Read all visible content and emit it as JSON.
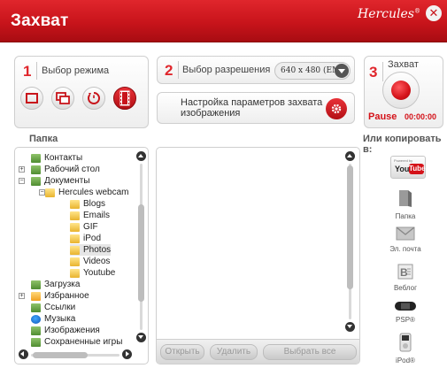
{
  "app": {
    "title": "Захват",
    "brand": "Hercules",
    "brand_mark": "®",
    "close_label": "✕"
  },
  "step1": {
    "number": "1",
    "label": "Выбор режима",
    "modes": [
      {
        "icon": "single-frame-icon",
        "active": false
      },
      {
        "icon": "burst-frames-icon",
        "active": false
      },
      {
        "icon": "timer-icon",
        "active": false
      },
      {
        "icon": "video-film-icon",
        "active": true
      }
    ]
  },
  "step2": {
    "number": "2",
    "label": "Выбор разрешения",
    "resolution_value": "640 x 480 (EMa"
  },
  "image_settings": {
    "label": "Настройка параметров захвата изображения"
  },
  "step3": {
    "number": "3",
    "label": "Захват",
    "pause_label": "Pause",
    "timer": "00:00:00"
  },
  "folders": {
    "label": "Папка",
    "items": [
      {
        "label": "Контакты",
        "icon": "green"
      },
      {
        "label": "Рабочий стол",
        "icon": "green"
      },
      {
        "label": "Документы",
        "icon": "green"
      },
      {
        "label": "Hercules webcam",
        "icon": "yellow"
      },
      {
        "label": "Blogs",
        "icon": "yellow"
      },
      {
        "label": "Emails",
        "icon": "yellow"
      },
      {
        "label": "GIF",
        "icon": "yellow"
      },
      {
        "label": "iPod",
        "icon": "yellow"
      },
      {
        "label": "Photos",
        "icon": "yellow",
        "selected": true
      },
      {
        "label": "Videos",
        "icon": "yellow"
      },
      {
        "label": "Youtube",
        "icon": "yellow"
      },
      {
        "label": "Загрузка",
        "icon": "green"
      },
      {
        "label": "Избранное",
        "icon": "orange"
      },
      {
        "label": "Ссылки",
        "icon": "green"
      },
      {
        "label": "Музыка",
        "icon": "blue"
      },
      {
        "label": "Изображения",
        "icon": "green"
      },
      {
        "label": "Сохраненные игры",
        "icon": "green"
      }
    ]
  },
  "files": {
    "open_label": "Открыть",
    "delete_label": "Удалить",
    "select_all_label": "Выбрать все"
  },
  "share": {
    "label": "Или копировать в:",
    "youtube_powered": "Powered by",
    "youtube_you": "You",
    "youtube_tube": "Tube",
    "targets": [
      {
        "label": "Папка",
        "icon": "folder-icon"
      },
      {
        "label": "Эл. почта",
        "icon": "mail-icon"
      },
      {
        "label": "Веблог",
        "icon": "blog-icon"
      },
      {
        "label": "PSP®",
        "icon": "psp-icon"
      },
      {
        "label": "iPod®",
        "icon": "ipod-icon"
      }
    ]
  },
  "colors": {
    "accent": "#d41219",
    "header": "#c8141b"
  }
}
